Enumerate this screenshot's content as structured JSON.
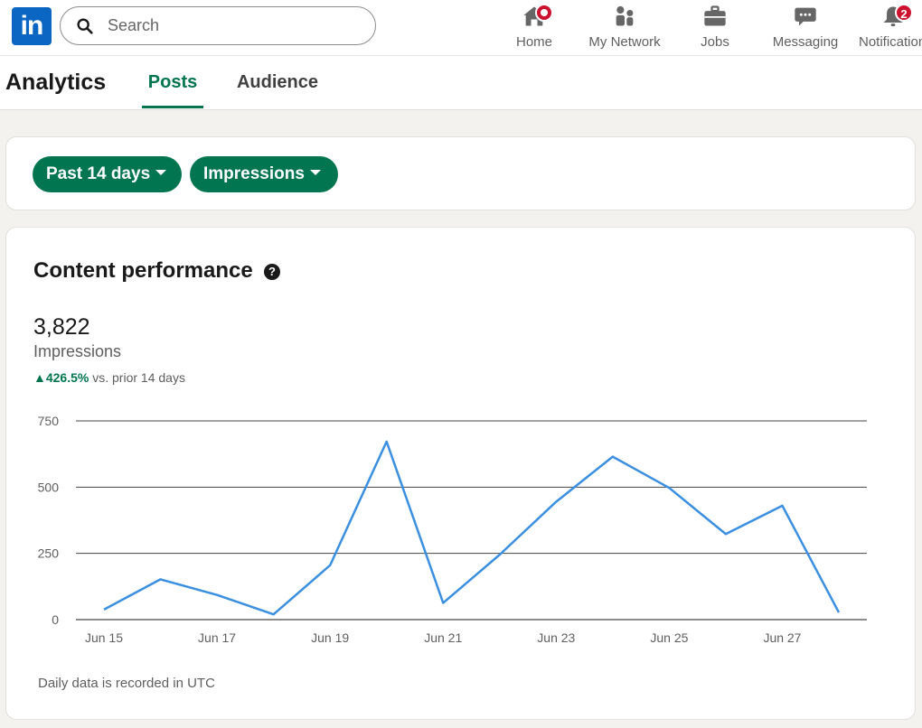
{
  "nav": {
    "logo": "in",
    "search_placeholder": "Search",
    "items": [
      {
        "label": "Home",
        "icon": "home-icon",
        "badge": ""
      },
      {
        "label": "My Network",
        "icon": "people-icon",
        "badge": ""
      },
      {
        "label": "Jobs",
        "icon": "briefcase-icon",
        "badge": ""
      },
      {
        "label": "Messaging",
        "icon": "chat-icon",
        "badge": ""
      },
      {
        "label": "Notifications",
        "icon": "bell-icon",
        "badge": "2"
      }
    ]
  },
  "subnav": {
    "title": "Analytics",
    "tabs": [
      {
        "label": "Posts",
        "active": true
      },
      {
        "label": "Audience",
        "active": false
      }
    ]
  },
  "filters": {
    "range": "Past 14 days",
    "metric": "Impressions"
  },
  "performance": {
    "title": "Content performance",
    "help": "?",
    "total": "3,822",
    "metric_label": "Impressions",
    "change_value": "426.5%",
    "change_text": " vs. prior 14 days",
    "footnote": "Daily data is recorded in UTC"
  },
  "colors": {
    "brand": "#0a66c2",
    "accent_green": "#01754f",
    "line": "#3b8fe0",
    "badge": "#cb112d"
  },
  "chart_data": {
    "type": "line",
    "x": [
      "Jun 15",
      "Jun 16",
      "Jun 17",
      "Jun 18",
      "Jun 19",
      "Jun 20",
      "Jun 21",
      "Jun 22",
      "Jun 23",
      "Jun 24",
      "Jun 25",
      "Jun 26",
      "Jun 27",
      "Jun 28"
    ],
    "x_tick_labels": [
      "Jun 15",
      "Jun 17",
      "Jun 19",
      "Jun 21",
      "Jun 23",
      "Jun 25",
      "Jun 27"
    ],
    "series": [
      {
        "values": [
          38,
          152,
          93,
          20,
          205,
          672,
          63,
          245,
          445,
          615,
          497,
          323,
          430,
          27
        ]
      }
    ],
    "yticks": [
      0,
      250,
      500,
      750
    ],
    "ylim": [
      0,
      750
    ],
    "grid": true
  }
}
